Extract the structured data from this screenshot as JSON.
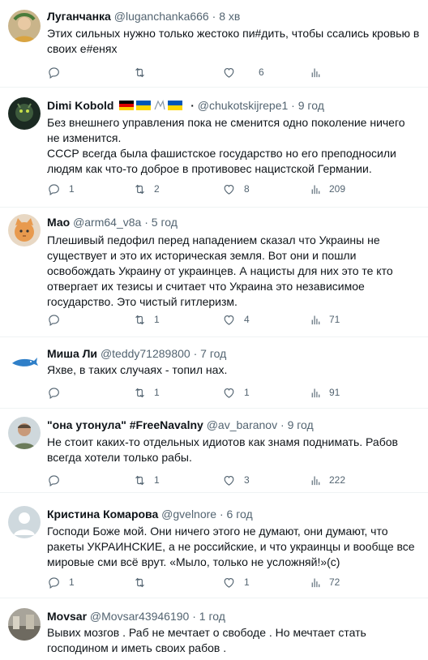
{
  "tweets": [
    {
      "name": "Луганчанка",
      "handle": "@luganchanka666",
      "dot": "·",
      "time": "8 хв",
      "text": "Этих сильных нужно только жестоко пи#дить, чтобы ссались кровью в своих е#енях",
      "reply": "",
      "retweet": "",
      "like": "6",
      "views": ""
    },
    {
      "name": "Dimi Kobold",
      "handle": "@chukotskijrepe1",
      "dot": "·",
      "dot2": "·",
      "time": "9 год",
      "text": "Без внешнего управления пока не сменится одно поколение ничего не изменится.\nСССР всегда была фашистское государство но его преподносили людям как что-то доброе в противовес нацистской Германии.",
      "reply": "1",
      "retweet": "2",
      "like": "8",
      "views": "209"
    },
    {
      "name": "Мао",
      "handle": "@arm64_v8a",
      "dot": "·",
      "time": "5 год",
      "text": "Плешивый педофил перед нападением сказал что Украины не существует и это их историческая земля. Вот они и пошли освобождать Украину от украинцев. А нацисты для них это те кто отвергает их тезисы и считает что Украина это независимое государство. Это чистый гитлеризм.",
      "reply": "",
      "retweet": "1",
      "like": "4",
      "views": "71"
    },
    {
      "name": "Миша Ли",
      "handle": "@teddy71289800",
      "dot": "·",
      "time": "7 год",
      "text": "Яхве, в таких случаях - топил нах.",
      "reply": "",
      "retweet": "1",
      "like": "1",
      "views": "91"
    },
    {
      "name": "\"она утонула\" #FreeNavalny",
      "handle": "@av_baranov",
      "dot": "·",
      "time": "9 год",
      "text": "Не стоит каких-то отдельных идиотов как знамя поднимать. Рабов всегда хотели только рабы.",
      "reply": "",
      "retweet": "1",
      "like": "3",
      "views": "222"
    },
    {
      "name": "Кристина Комарова",
      "handle": "@gvelnore",
      "dot": "·",
      "time": "6 год",
      "text": "Господи Боже мой. Они ничего этого не думают, они думают, что ракеты УКРАИНСКИЕ, а не российские, и что украинцы и вообще все мировые сми всё врут. «Мыло, только не усложняй!»(с)",
      "reply": "1",
      "retweet": "",
      "like": "1",
      "views": "72"
    },
    {
      "name": "Movsar",
      "handle": "@Movsar43946190",
      "dot": "·",
      "time": "1 год",
      "text": "Вывих мозгов . Раб не мечтает о свободе . Но мечтает стать господином и иметь своих рабов .",
      "reply": "",
      "retweet": "",
      "like": "",
      "views": ""
    }
  ],
  "colors": {
    "text": "#0f1419",
    "muted": "#536471",
    "border": "#eff3f4"
  }
}
